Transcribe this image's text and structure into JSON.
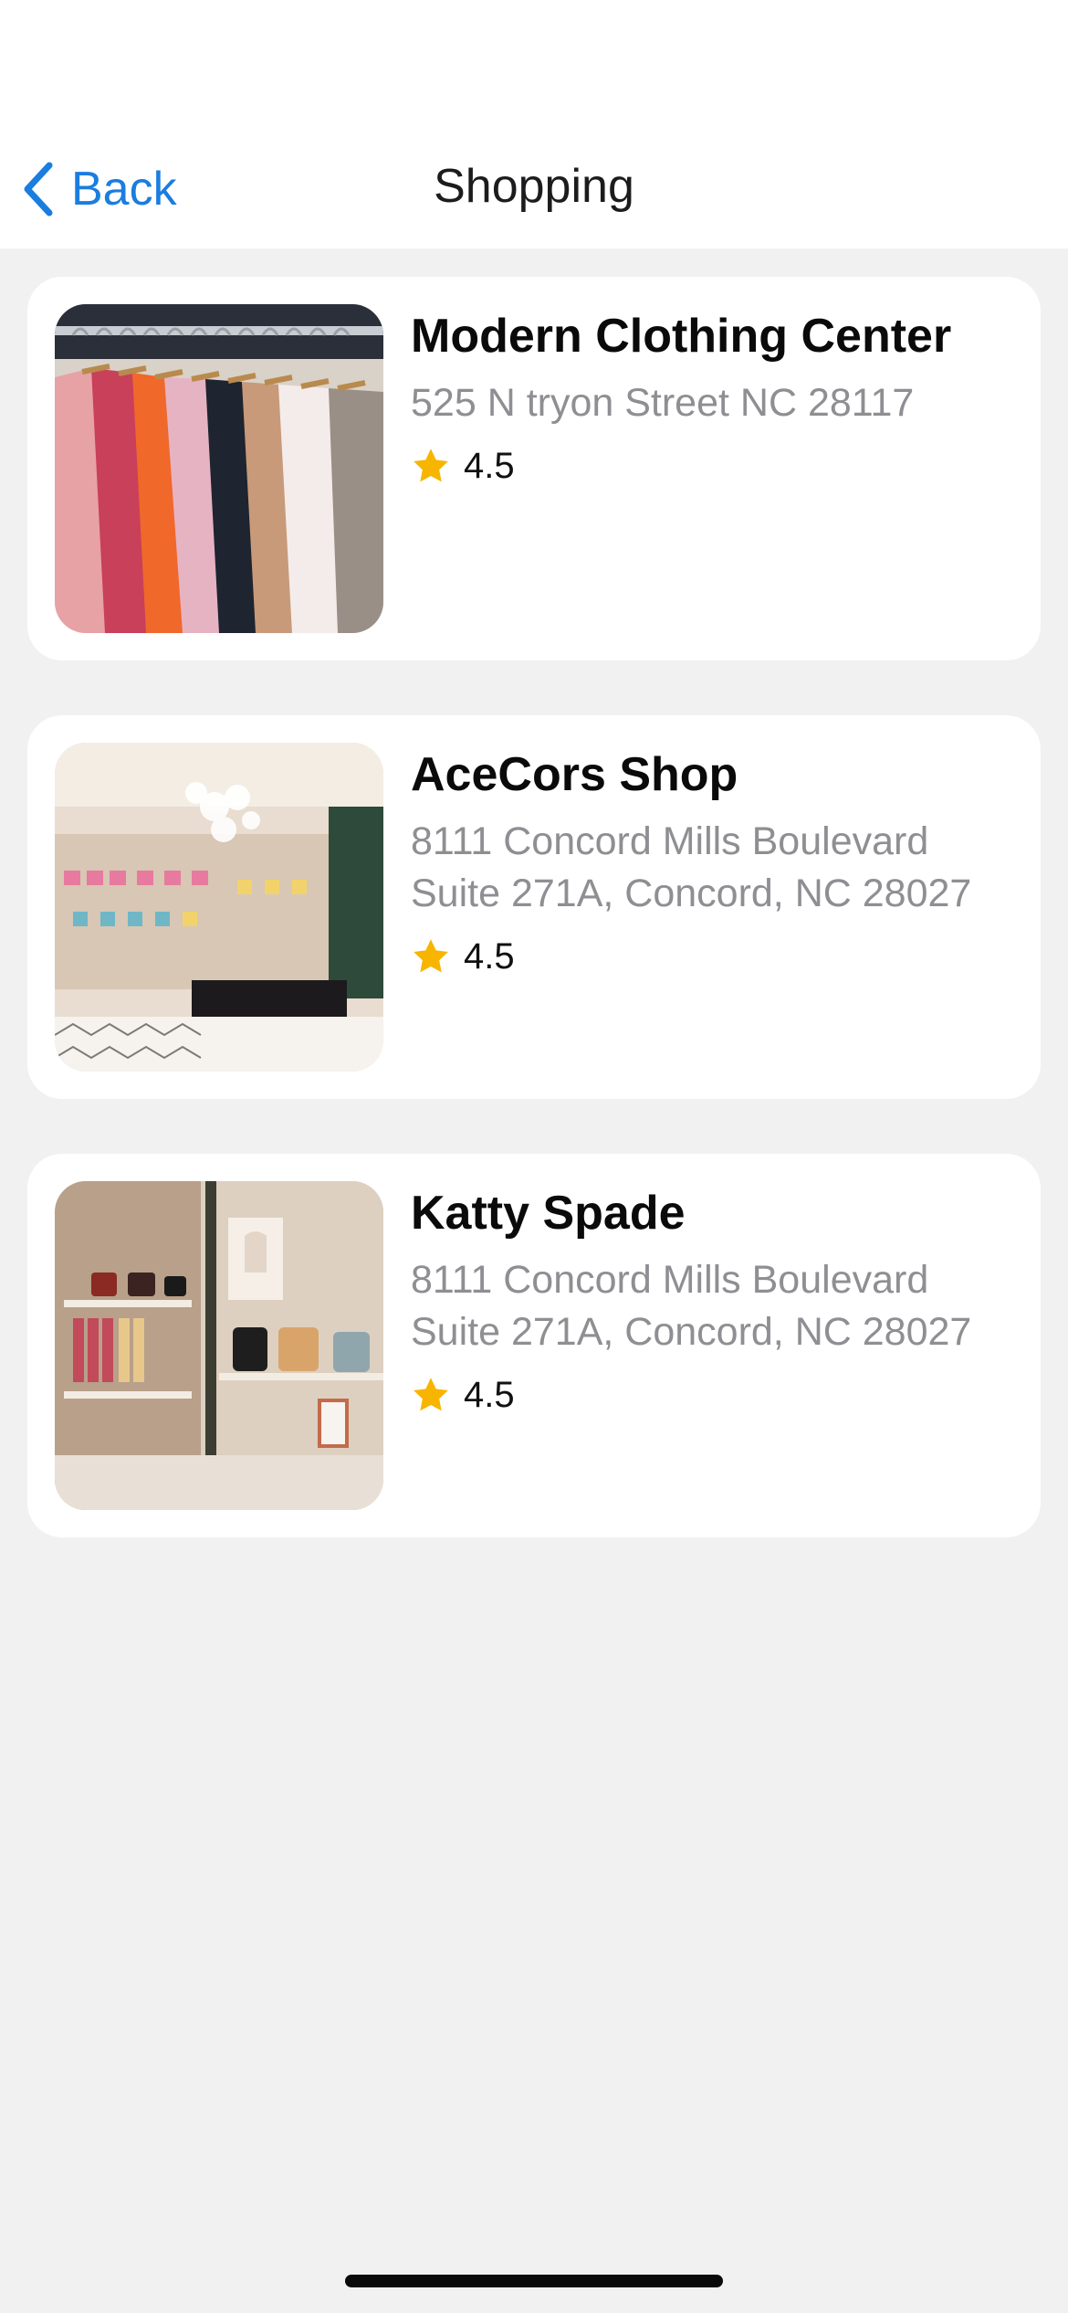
{
  "nav": {
    "back_label": "Back",
    "title": "Shopping"
  },
  "stores": [
    {
      "name": "Modern Clothing Center",
      "address": "525 N tryon Street NC 28117",
      "rating": "4.5",
      "image_icon": "clothing-rack-photo"
    },
    {
      "name": "AceCors Shop",
      "address": "8111 Concord Mills Boulevard Suite 271A, Concord, NC 28027",
      "rating": "4.5",
      "image_icon": "boutique-interior-photo"
    },
    {
      "name": "Katty Spade",
      "address": "8111 Concord Mills Boulevard Suite 271A, Concord, NC 28027",
      "rating": "4.5",
      "image_icon": "handbag-store-photo"
    }
  ],
  "colors": {
    "accent": "#1a7de0",
    "star": "#f7b500",
    "background": "#f1f1f1",
    "secondary_text": "#8e8e93"
  }
}
